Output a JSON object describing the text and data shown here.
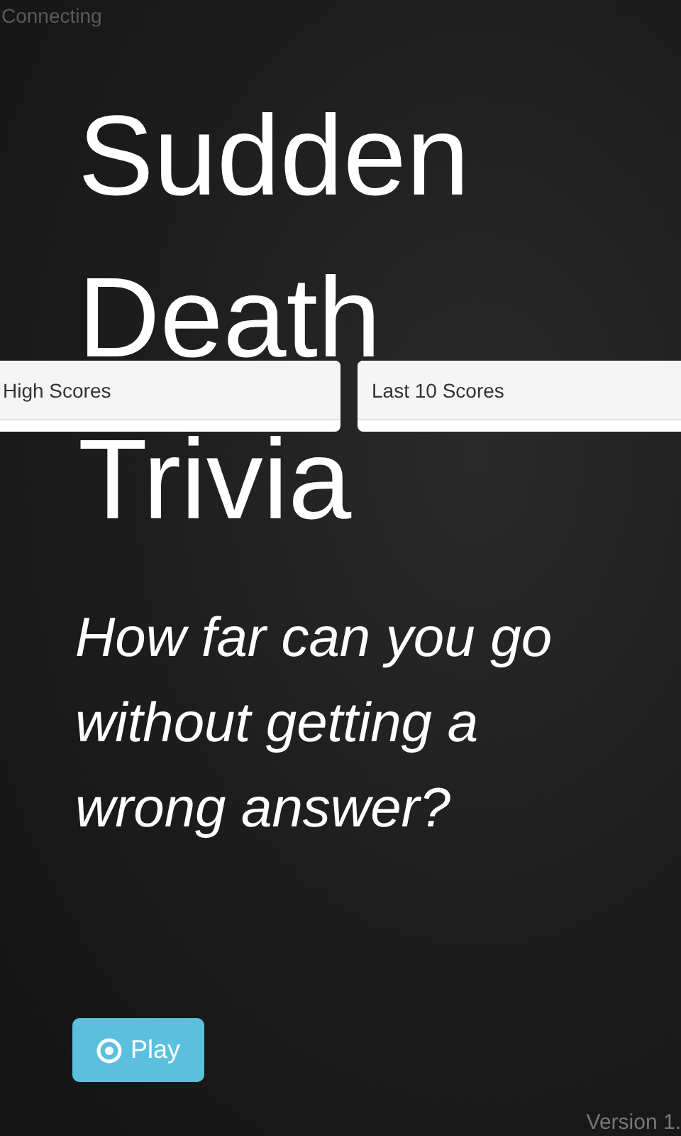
{
  "status": "Connecting",
  "title_lines": [
    "Sudden",
    "Death",
    "Trivia"
  ],
  "tagline": "How far can you go without getting a wrong answer?",
  "panels": [
    {
      "heading": "High Scores"
    },
    {
      "heading": "Last 10 Scores"
    }
  ],
  "play_button": {
    "label": "Play"
  },
  "version": "Version 1."
}
